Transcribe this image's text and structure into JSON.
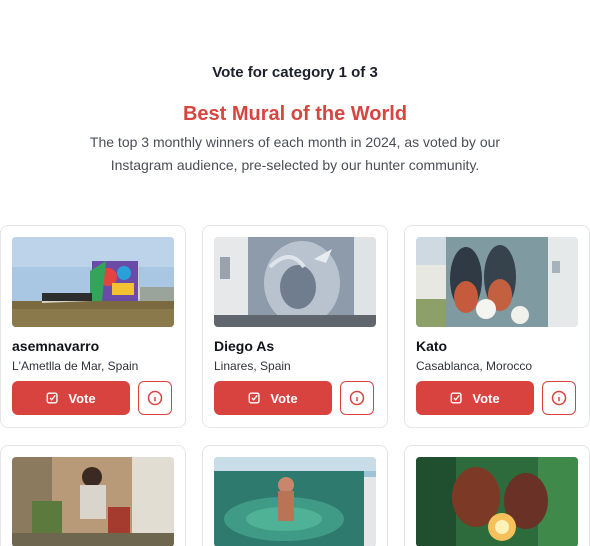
{
  "header": {
    "step": "Vote for category 1 of 3",
    "title": "Best Mural of the World",
    "description": "The top 3 monthly winners of each month in 2024, as voted by our Instagram audience, pre-selected by our hunter community."
  },
  "cards": [
    {
      "artist": "asemnavarro",
      "location": "L'Ametlla de Mar, Spain",
      "vote_label": "Vote"
    },
    {
      "artist": "Diego As",
      "location": "Linares, Spain",
      "vote_label": "Vote"
    },
    {
      "artist": "Kato",
      "location": "Casablanca, Morocco",
      "vote_label": "Vote"
    },
    {
      "artist": "",
      "location": "",
      "vote_label": ""
    },
    {
      "artist": "",
      "location": "",
      "vote_label": ""
    },
    {
      "artist": "",
      "location": "",
      "vote_label": ""
    }
  ],
  "icons": {
    "vote": "checkbox-edit-icon",
    "info": "info-circle-icon"
  },
  "colors": {
    "accent": "#d8433f",
    "title": "#d6453f"
  }
}
